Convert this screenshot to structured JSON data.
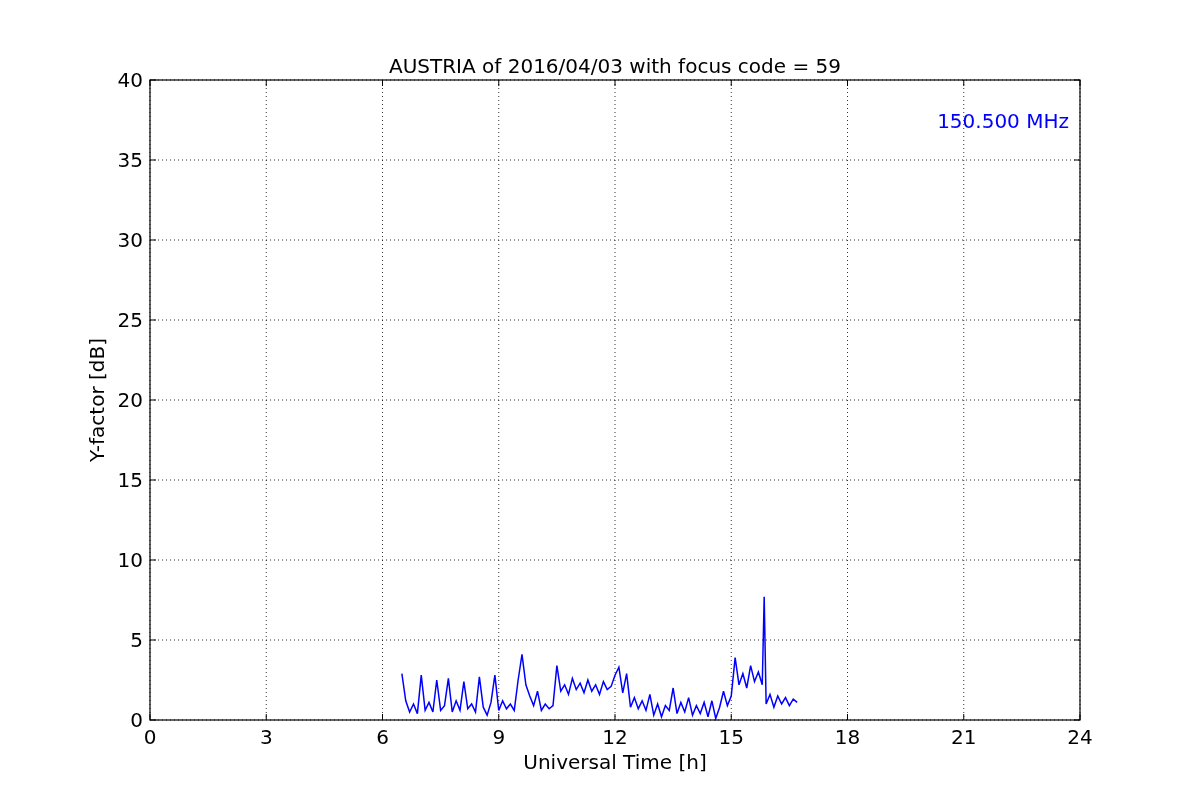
{
  "chart_data": {
    "type": "line",
    "title": "AUSTRIA of 2016/04/03 with focus code = 59",
    "xlabel": "Universal Time [h]",
    "ylabel": "Y-factor [dB]",
    "xlim": [
      0,
      24
    ],
    "ylim": [
      0,
      40
    ],
    "xticks": [
      0,
      3,
      6,
      9,
      12,
      15,
      18,
      21,
      24
    ],
    "yticks": [
      0,
      5,
      10,
      15,
      20,
      25,
      30,
      35,
      40
    ],
    "x": [
      6.5,
      6.6,
      6.7,
      6.8,
      6.9,
      7.0,
      7.1,
      7.2,
      7.3,
      7.4,
      7.5,
      7.6,
      7.7,
      7.8,
      7.9,
      8.0,
      8.1,
      8.2,
      8.3,
      8.4,
      8.5,
      8.6,
      8.7,
      8.8,
      8.9,
      9.0,
      9.1,
      9.2,
      9.3,
      9.4,
      9.5,
      9.6,
      9.7,
      9.8,
      9.9,
      10.0,
      10.1,
      10.2,
      10.3,
      10.4,
      10.5,
      10.6,
      10.7,
      10.8,
      10.9,
      11.0,
      11.1,
      11.2,
      11.3,
      11.4,
      11.5,
      11.6,
      11.7,
      11.8,
      11.9,
      12.0,
      12.1,
      12.2,
      12.3,
      12.4,
      12.5,
      12.6,
      12.7,
      12.8,
      12.9,
      13.0,
      13.1,
      13.2,
      13.3,
      13.4,
      13.5,
      13.6,
      13.7,
      13.8,
      13.9,
      14.0,
      14.1,
      14.2,
      14.3,
      14.4,
      14.5,
      14.6,
      14.7,
      14.8,
      14.9,
      15.0,
      15.1,
      15.2,
      15.3,
      15.4,
      15.5,
      15.6,
      15.7,
      15.8,
      15.85,
      15.9,
      16.0,
      16.1,
      16.2,
      16.3,
      16.4,
      16.5,
      16.6,
      16.7
    ],
    "series": [
      {
        "color": "#0000ff",
        "values": [
          2.9,
          1.2,
          0.5,
          1.0,
          0.4,
          2.8,
          0.6,
          1.1,
          0.5,
          2.5,
          0.6,
          0.9,
          2.6,
          0.5,
          1.2,
          0.6,
          2.4,
          0.7,
          1.0,
          0.5,
          2.7,
          0.8,
          0.3,
          1.1,
          2.8,
          0.6,
          1.2,
          0.7,
          1.0,
          0.6,
          2.5,
          4.1,
          2.2,
          1.5,
          0.9,
          1.8,
          0.6,
          1.0,
          0.7,
          0.9,
          3.4,
          1.8,
          2.2,
          1.6,
          2.6,
          1.9,
          2.3,
          1.7,
          2.5,
          1.8,
          2.2,
          1.6,
          2.4,
          1.9,
          2.1,
          2.8,
          3.3,
          1.7,
          2.9,
          0.8,
          1.4,
          0.7,
          1.2,
          0.6,
          1.6,
          0.3,
          1.0,
          0.2,
          0.9,
          0.6,
          2.0,
          0.4,
          1.1,
          0.5,
          1.4,
          0.3,
          0.9,
          0.4,
          1.1,
          0.2,
          1.2,
          0.1,
          0.8,
          1.8,
          0.9,
          1.5,
          3.9,
          2.2,
          2.9,
          2.0,
          3.4,
          2.4,
          3.0,
          2.2,
          7.7,
          1.0,
          1.6,
          0.8,
          1.5,
          1.0,
          1.4,
          0.9,
          1.3,
          1.1
        ]
      }
    ],
    "grid": true,
    "annotations": [
      {
        "text": "150.500 MHz"
      }
    ]
  }
}
